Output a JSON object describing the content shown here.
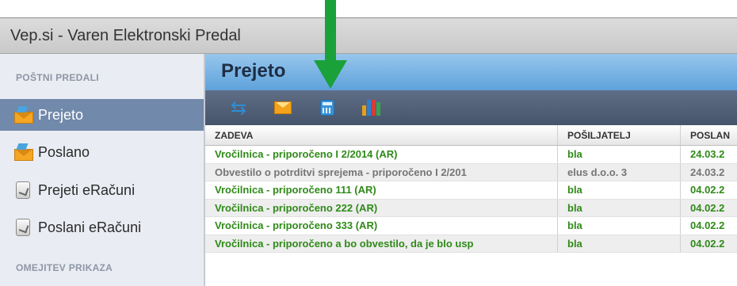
{
  "window": {
    "title": "Vep.si - Varen Elektronski Predal"
  },
  "annotation": {
    "arrow_color": "#1aa13a"
  },
  "sidebar": {
    "heading": "POŠTNI PREDALI",
    "items": [
      {
        "label": "Prejeto",
        "icon": "inbox-envelope-icon",
        "active": true
      },
      {
        "label": "Poslano",
        "icon": "sent-envelope-icon",
        "active": false
      },
      {
        "label": "Prejeti eRačuni",
        "icon": "received-invoice-icon",
        "active": false
      },
      {
        "label": "Poslani eRačuni",
        "icon": "sent-invoice-icon",
        "active": false
      }
    ],
    "heading2": "OMEJITEV PRIKAZA"
  },
  "main": {
    "title": "Prejeto"
  },
  "toolbar": {
    "buttons": [
      {
        "icon": "refresh-icon"
      },
      {
        "icon": "envelope-icon"
      },
      {
        "icon": "calculator-icon"
      },
      {
        "icon": "books-icon"
      }
    ]
  },
  "table": {
    "columns": [
      "ZADEVA",
      "POŠILJATELJ",
      "POSLAN"
    ],
    "rows": [
      {
        "subject": "Vročilnica - priporočeno I 2/2014 (AR)",
        "sender": "bla",
        "sent": "24.03.2",
        "read": false
      },
      {
        "subject": "Obvestilo o potrditvi sprejema - priporočeno I 2/201",
        "sender": "elus d.o.o. 3",
        "sent": "24.03.2",
        "read": true
      },
      {
        "subject": "Vročilnica - priporočeno 111 (AR)",
        "sender": "bla",
        "sent": "04.02.2",
        "read": false
      },
      {
        "subject": "Vročilnica - priporočeno 222 (AR)",
        "sender": "bla",
        "sent": "04.02.2",
        "read": false
      },
      {
        "subject": "Vročilnica - priporočeno 333 (AR)",
        "sender": "bla",
        "sent": "04.02.2",
        "read": false
      },
      {
        "subject": "Vročilnica - priporočeno a bo obvestilo, da je blo usp",
        "sender": "bla",
        "sent": "04.02.2",
        "read": false
      }
    ]
  },
  "colors": {
    "unread_text": "#2f8a18",
    "read_text": "#757575",
    "active_item": "#7189aa"
  }
}
